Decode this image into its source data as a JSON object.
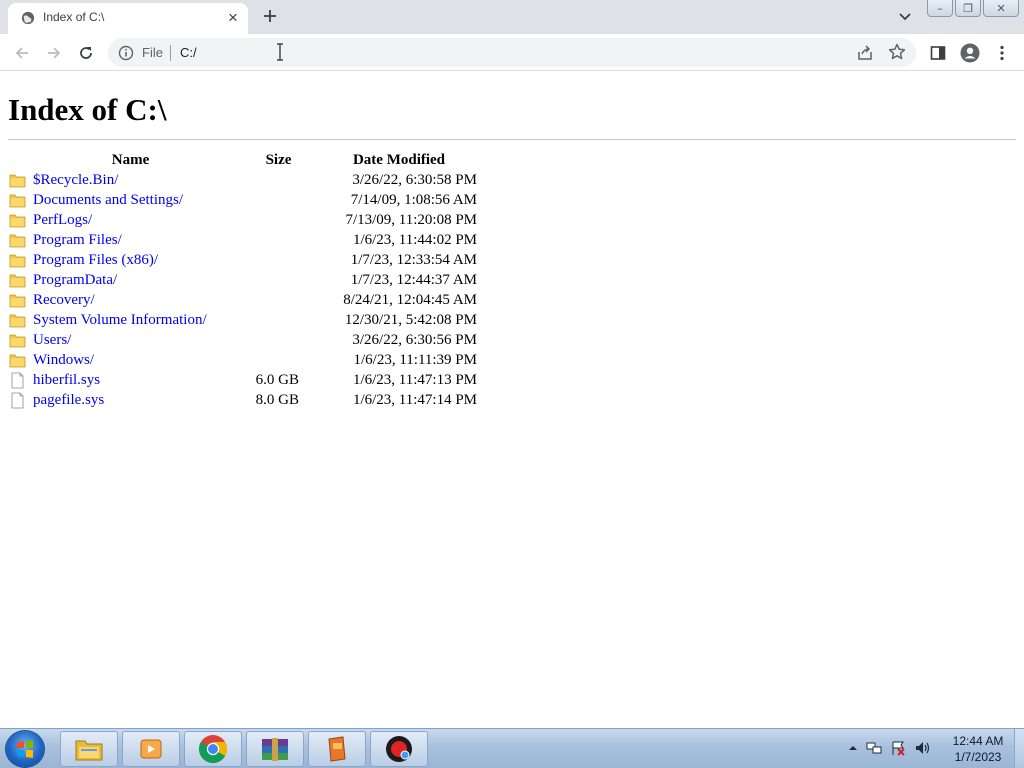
{
  "browser": {
    "tab": {
      "title": "Index of C:\\",
      "close": "×"
    },
    "new_tab": "+",
    "window_buttons": {
      "minimize": "–",
      "restore": "❐",
      "close": "✕"
    }
  },
  "toolbar": {
    "scheme_label": "File",
    "url": "C:/"
  },
  "page": {
    "heading": "Index of C:\\",
    "columns": {
      "name": "Name",
      "size": "Size",
      "date": "Date Modified"
    },
    "entries": [
      {
        "name": "$Recycle.Bin/",
        "type": "folder",
        "size": "",
        "date": "3/26/22, 6:30:58 PM"
      },
      {
        "name": "Documents and Settings/",
        "type": "folder",
        "size": "",
        "date": "7/14/09, 1:08:56 AM"
      },
      {
        "name": "PerfLogs/",
        "type": "folder",
        "size": "",
        "date": "7/13/09, 11:20:08 PM"
      },
      {
        "name": "Program Files/",
        "type": "folder",
        "size": "",
        "date": "1/6/23, 11:44:02 PM"
      },
      {
        "name": "Program Files (x86)/",
        "type": "folder",
        "size": "",
        "date": "1/7/23, 12:33:54 AM"
      },
      {
        "name": "ProgramData/",
        "type": "folder",
        "size": "",
        "date": "1/7/23, 12:44:37 AM"
      },
      {
        "name": "Recovery/",
        "type": "folder",
        "size": "",
        "date": "8/24/21, 12:04:45 AM"
      },
      {
        "name": "System Volume Information/",
        "type": "folder",
        "size": "",
        "date": "12/30/21, 5:42:08 PM"
      },
      {
        "name": "Users/",
        "type": "folder",
        "size": "",
        "date": "3/26/22, 6:30:56 PM"
      },
      {
        "name": "Windows/",
        "type": "folder",
        "size": "",
        "date": "1/6/23, 11:11:39 PM"
      },
      {
        "name": "hiberfil.sys",
        "type": "file",
        "size": "6.0 GB",
        "date": "1/6/23, 11:47:13 PM"
      },
      {
        "name": "pagefile.sys",
        "type": "file",
        "size": "8.0 GB",
        "date": "1/6/23, 11:47:14 PM"
      }
    ]
  },
  "taskbar": {
    "apps": [
      "windows-explorer",
      "media-player",
      "chrome",
      "winrar",
      "app-orange",
      "recorder"
    ],
    "clock": {
      "time": "12:44 AM",
      "date": "1/7/2023"
    }
  },
  "colors": {
    "link": "#0000ee",
    "folder": "#f4c542",
    "tabstrip": "#dee1e6",
    "omnibox": "#f1f3f4"
  }
}
